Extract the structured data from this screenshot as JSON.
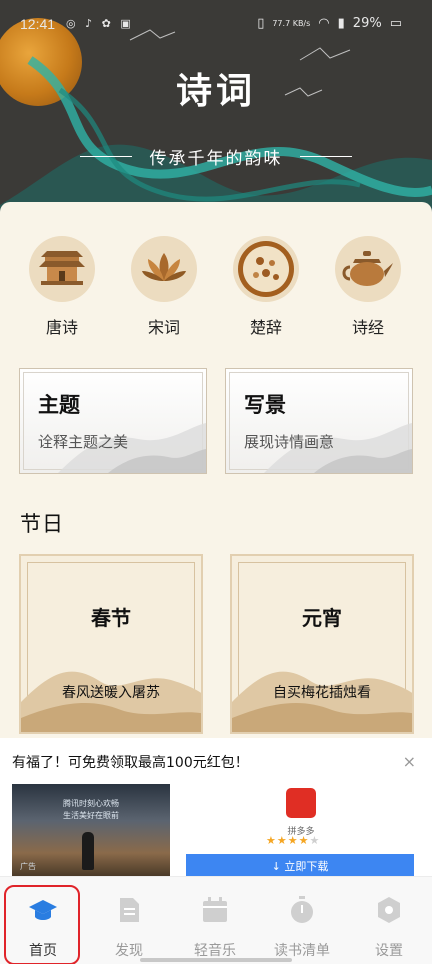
{
  "status_bar": {
    "time": "12:41",
    "speed": "77.7 KB/s",
    "battery": "29%"
  },
  "hero": {
    "title": "诗词",
    "subtitle": "传承千年的韵味"
  },
  "categories": [
    {
      "label": "唐诗",
      "icon": "pagoda-icon"
    },
    {
      "label": "宋词",
      "icon": "lotus-icon"
    },
    {
      "label": "楚辞",
      "icon": "plate-icon"
    },
    {
      "label": "诗经",
      "icon": "teapot-icon"
    }
  ],
  "topic_cards": [
    {
      "title": "主题",
      "desc": "诠释主题之美"
    },
    {
      "title": "写景",
      "desc": "展现诗情画意"
    }
  ],
  "festival_section": {
    "title": "节日",
    "items": [
      {
        "title": "春节",
        "desc": "春风送暖入屠苏"
      },
      {
        "title": "元宵",
        "desc": "自买梅花插烛看"
      }
    ]
  },
  "ad": {
    "text": "有福了！可免费领取最高100元红包！",
    "close": "×",
    "image_line1": "腾讯时刻心欢畅",
    "image_line2": "生活美好在眼前",
    "image_tag": "广告",
    "brand": "拼多多",
    "stars": 4,
    "button": "立即下载"
  },
  "tabbar": {
    "items": [
      {
        "label": "首页",
        "icon": "graduation-cap-icon",
        "active": true
      },
      {
        "label": "发现",
        "icon": "document-icon",
        "active": false
      },
      {
        "label": "轻音乐",
        "icon": "calendar-icon",
        "active": false
      },
      {
        "label": "读书清单",
        "icon": "stopwatch-icon",
        "active": false
      },
      {
        "label": "设置",
        "icon": "settings-icon",
        "active": false
      }
    ]
  },
  "colors": {
    "hero_bg": "#3b3a37",
    "panel_bg": "#f9f4e8",
    "category_circle": "#ecdcc0",
    "accent_teal": "#1f8f86",
    "tab_active": "#2a7de1",
    "highlight_red": "#e0242a"
  }
}
